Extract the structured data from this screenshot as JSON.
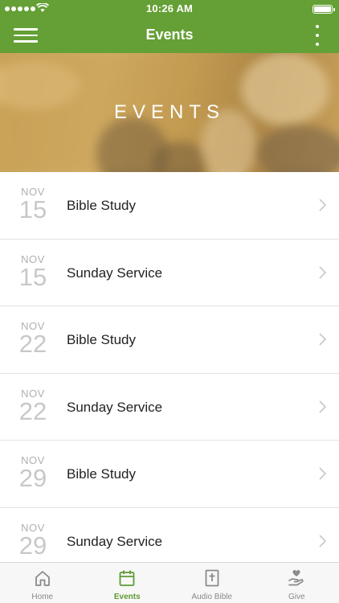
{
  "status_bar": {
    "time": "10:26 AM"
  },
  "nav": {
    "title": "Events"
  },
  "hero": {
    "title": "EVENTS"
  },
  "events": [
    {
      "month": "NOV",
      "day": "15",
      "title": "Bible Study"
    },
    {
      "month": "NOV",
      "day": "15",
      "title": "Sunday Service"
    },
    {
      "month": "NOV",
      "day": "22",
      "title": "Bible Study"
    },
    {
      "month": "NOV",
      "day": "22",
      "title": "Sunday Service"
    },
    {
      "month": "NOV",
      "day": "29",
      "title": "Bible Study"
    },
    {
      "month": "NOV",
      "day": "29",
      "title": "Sunday Service"
    }
  ],
  "tabs": [
    {
      "label": "Home",
      "icon": "home-icon",
      "active": false
    },
    {
      "label": "Events",
      "icon": "calendar-icon",
      "active": true
    },
    {
      "label": "Audio Bible",
      "icon": "bible-icon",
      "active": false
    },
    {
      "label": "Give",
      "icon": "give-icon",
      "active": false
    }
  ],
  "colors": {
    "brand_green": "#64a035",
    "active_tab": "#5d9b33",
    "inactive_tab": "#888888"
  }
}
